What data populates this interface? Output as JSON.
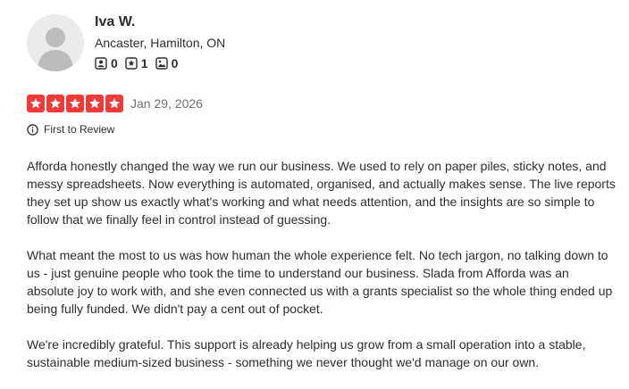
{
  "reviewer": {
    "name": "Iva W.",
    "location": "Ancaster, Hamilton, ON",
    "stats": {
      "friends": "0",
      "reviews": "1",
      "photos": "0"
    }
  },
  "rating": {
    "stars": 5,
    "date": "Jan 29, 2026"
  },
  "badge": {
    "label": "First to Review"
  },
  "review": {
    "paragraphs": [
      "Afforda honestly changed the way we run our business. We used to rely on paper piles, sticky notes, and messy spreadsheets. Now everything is automated, organised, and actually makes sense. The live reports they set up show us exactly what's working and what needs attention, and the insights are so simple to follow that we finally feel in control instead of guessing.",
      "What meant the most to us was how human the whole experience felt. No tech jargon, no talking down to us - just genuine people who took the time to understand our business. Slada from Afforda was an absolute joy to work with, and she even connected us with a grants specialist so the whole thing ended up being fully funded. We didn't pay a cent out of pocket.",
      "We're incredibly grateful. This support is already helping us grow from a small operation into a stable, sustainable medium-sized business - something we never thought we'd manage on our own."
    ]
  },
  "colors": {
    "star": "#f43939",
    "text": "#2d2e2f",
    "muted": "#6e7072"
  },
  "icons": [
    "avatar-placeholder",
    "friends-icon",
    "reviews-icon",
    "photos-icon",
    "star-icon",
    "info-icon"
  ]
}
